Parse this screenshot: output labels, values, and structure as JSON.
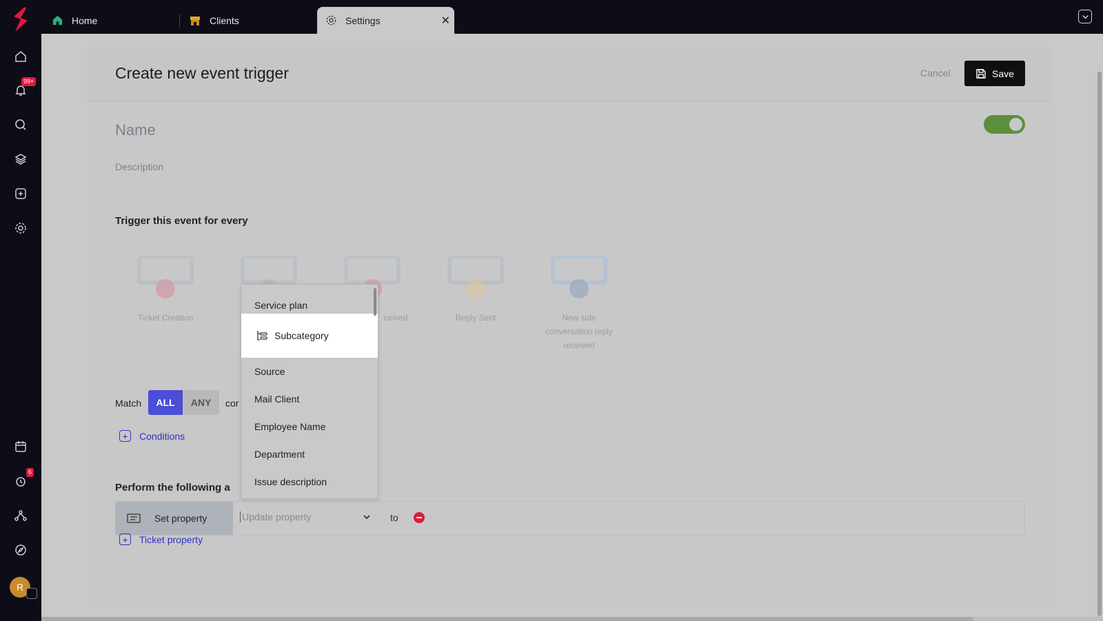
{
  "rail": {
    "notification_badge": "99+",
    "timer_badge": "6",
    "avatar_initial": "R",
    "icons": [
      "home-icon",
      "bell-icon",
      "search-icon",
      "layers-icon",
      "plus-square-icon",
      "gear-icon",
      "calendar-icon",
      "timer-icon",
      "workflow-icon",
      "compass-icon"
    ]
  },
  "tabs": [
    {
      "label": "Home",
      "icon": "home-icon"
    },
    {
      "label": "Clients",
      "icon": "store-icon"
    },
    {
      "label": "Settings",
      "icon": "gear-icon"
    }
  ],
  "page": {
    "title": "Create new event trigger",
    "cancel_label": "Cancel",
    "save_label": "Save",
    "enabled": true,
    "name_placeholder": "Name",
    "description_placeholder": "Description",
    "trigger_heading": "Trigger this event for every"
  },
  "triggers": [
    {
      "label": "Ticket Creation",
      "color": "#e06b80"
    },
    {
      "label": "",
      "color": "#9aa4b0"
    },
    {
      "label": "ceived",
      "color": "#e06b80"
    },
    {
      "label": "Reply Sent",
      "color": "#e7c67a"
    },
    {
      "label": "New side conversation reply received",
      "color": "#6b8bb8"
    }
  ],
  "match": {
    "label": "Match",
    "all": "ALL",
    "any": "ANY",
    "tail": "cor",
    "selected": "ALL"
  },
  "conditions_link": "Conditions",
  "actions": {
    "heading": "Perform the following a",
    "set_property": "Set property",
    "property_placeholder": "Update property",
    "to_label": "to",
    "add_link": "Ticket property"
  },
  "dropdown": {
    "items": [
      "Service plan",
      "Subcategory",
      "Source",
      "Mail Client",
      "Employee Name",
      "Department",
      "Issue description"
    ],
    "highlighted": "Subcategory"
  },
  "colors": {
    "accent": "#4b4ed6",
    "link": "#2e31c7",
    "toggle_on": "#5a8f3c",
    "badge": "#e0193f",
    "rail_bg": "#0d0d17"
  }
}
